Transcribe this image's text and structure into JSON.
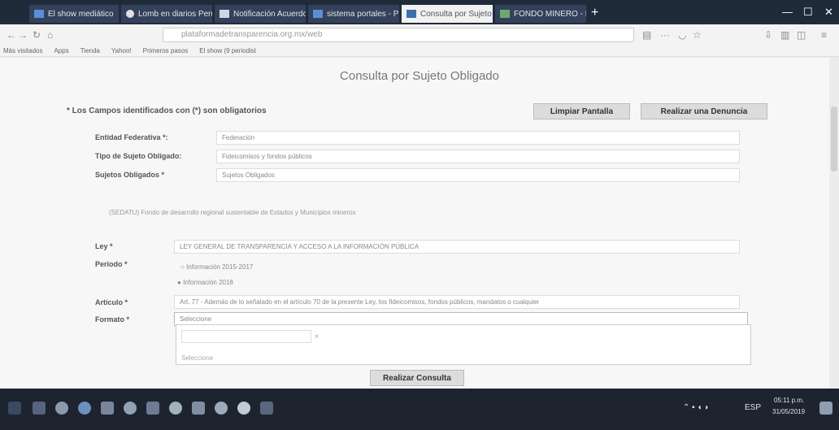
{
  "browser": {
    "tabs": [
      {
        "label": "El show mediático",
        "active": false,
        "color": "#5a8fd8"
      },
      {
        "label": "Lomb en diarios Peru",
        "active": false,
        "color": "#e0e0e0"
      },
      {
        "label": "Notificación Acuerdo",
        "active": false,
        "color": "#cfd6df"
      },
      {
        "label": "sistema portales - PNT",
        "active": false,
        "color": "#5a8fd8"
      },
      {
        "label": "Consulta por Sujeto",
        "active": true,
        "color": "#3b6fb0"
      },
      {
        "label": "FONDO MINERO - Bu",
        "active": false,
        "color": "#6fa86f"
      }
    ],
    "new_tab": "+",
    "window_controls": [
      "—",
      "☐",
      "✕"
    ],
    "url": "plataformadetransparencia.org.mx/web",
    "bookmarks": [
      "Más visitados",
      "Apps",
      "Tienda",
      "Yahoo!",
      "Primeros pasos",
      "El show (9 periodist"
    ]
  },
  "page": {
    "title": "Consulta por Sujeto Obligado",
    "required_note": "* Los Campos identificados con (*) son obligatorios",
    "clear_button": "Limpiar Pantalla",
    "complaint_button": "Realizar una Denuncia",
    "entity_label": "Entidad Federativa *:",
    "entity_value": "Federación",
    "subject_type_label": "Tipo de Sujeto Obligado:",
    "subject_type_value": "Fideicomisos y fondos públicos",
    "subjects_label": "Sujetos Obligados *",
    "subjects_value": "Sujetos Obligados",
    "selected_subject": "(SEDATU) Fondo de desarrollo regional sustentable de Estados y Municipios mineros",
    "law_label": "Ley *",
    "law_value": "LEY GENERAL DE TRANSPARENCIA Y ACCESO A LA INFORMACIÓN PÚBLICA",
    "period_label": "Periodo *",
    "period_option_1": "Información 2015-2017",
    "period_option_2": "Información 2018",
    "article_label": "Artículo *",
    "article_value": "Art. 77 - Además de lo señalado en el artículo 70 de la presente Ley, los fideicomisos, fondos públicos, mandatos o cualquier",
    "format_label": "Formato *",
    "format_value": "Seleccione",
    "format_option": "Seleccione",
    "query_button": "Realizar Consulta"
  },
  "taskbar": {
    "language": "ESP",
    "time": "05:11 p.m.",
    "date": "31/05/2019"
  }
}
